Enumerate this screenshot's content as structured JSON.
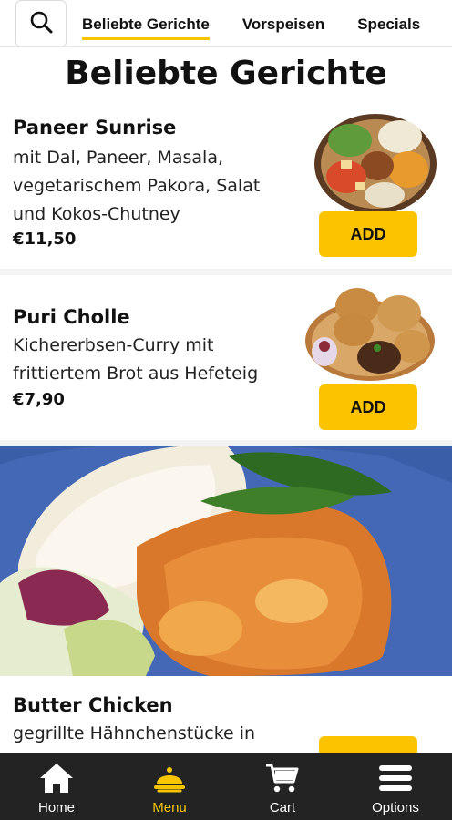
{
  "tabs": [
    {
      "label": "Beliebte Gerichte",
      "active": true
    },
    {
      "label": "Vorspeisen",
      "active": false
    },
    {
      "label": "Specials",
      "active": false
    }
  ],
  "section_title": "Beliebte Gerichte",
  "items": [
    {
      "name": "Paneer Sunrise",
      "desc_lines": [
        "mit Dal, Paneer, Masala,",
        "vegetarischem Pakora, Salat",
        "und Kokos-Chutney"
      ],
      "price": "€11,50",
      "add_label": "ADD"
    },
    {
      "name": "Puri Cholle",
      "desc_lines": [
        "Kichererbsen-Curry mit",
        "frittiertem Brot aus Hefeteig"
      ],
      "price": "€7,90",
      "add_label": "ADD"
    },
    {
      "name": "Butter Chicken",
      "desc_lines": [
        "gegrillte Hähnchenstücke in"
      ]
    }
  ],
  "nav": [
    {
      "label": "Home",
      "icon": "home-icon",
      "active": false
    },
    {
      "label": "Menu",
      "icon": "menu-dish-icon",
      "active": true
    },
    {
      "label": "Cart",
      "icon": "cart-icon",
      "active": false
    },
    {
      "label": "Options",
      "icon": "options-icon",
      "active": false
    }
  ],
  "colors": {
    "accent": "#fcc400",
    "nav_bg": "#232323",
    "active_nav": "#f7c600"
  }
}
